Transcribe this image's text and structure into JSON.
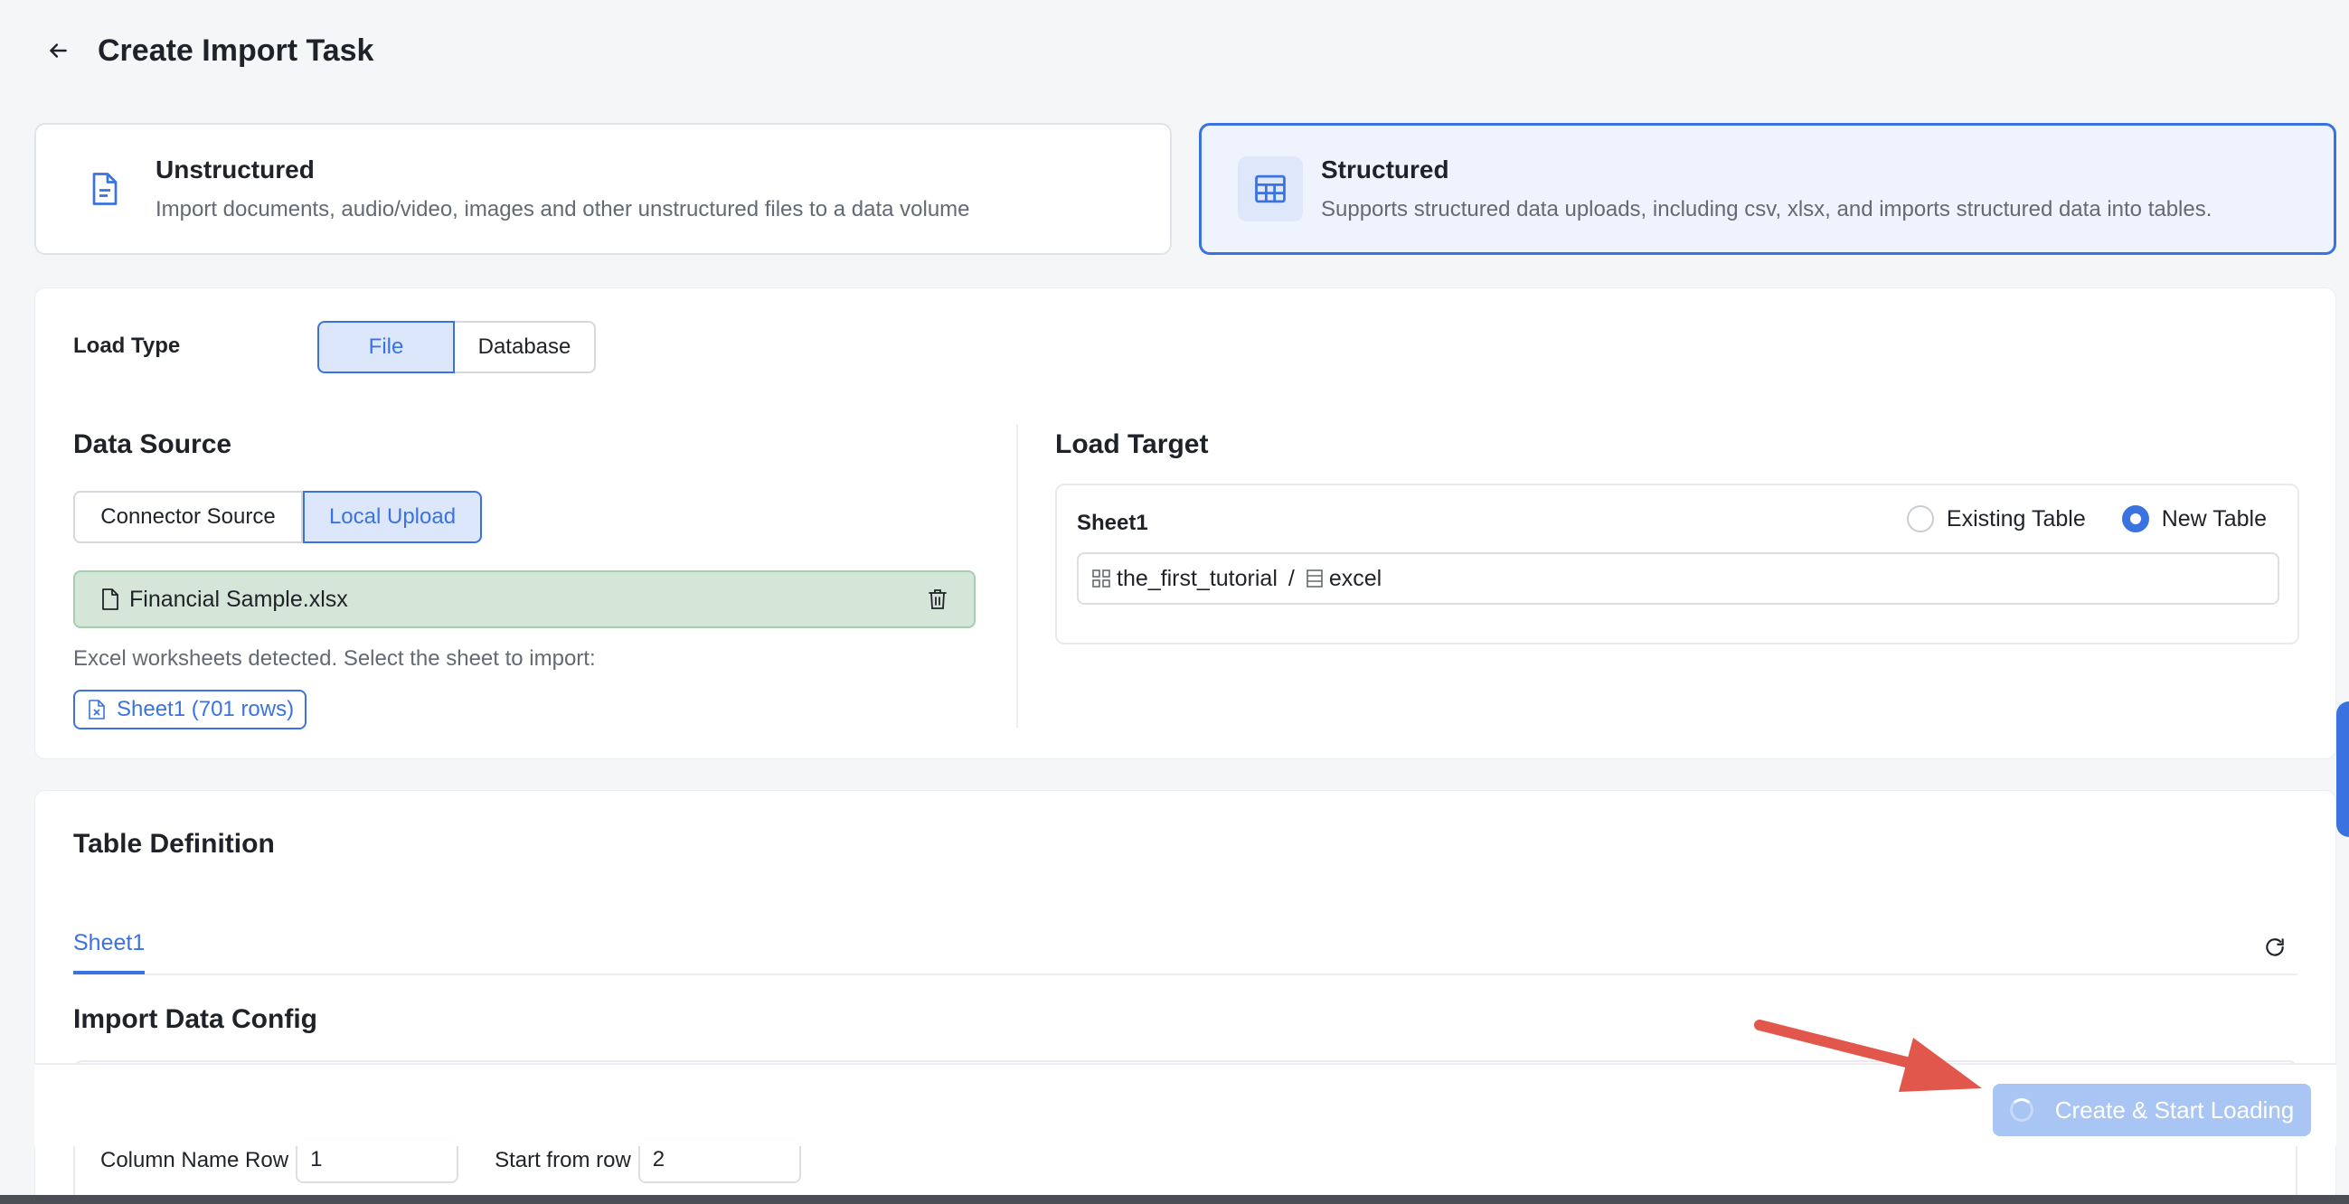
{
  "header": {
    "title": "Create Import Task"
  },
  "import_types": {
    "unstructured": {
      "title": "Unstructured",
      "description": "Import documents, audio/video, images and other unstructured files to a data volume"
    },
    "structured": {
      "title": "Structured",
      "description": "Supports structured data uploads, including csv, xlsx, and imports structured data into tables."
    }
  },
  "load_type": {
    "label": "Load Type",
    "options": [
      "File",
      "Database"
    ],
    "selected": "File"
  },
  "data_source": {
    "title": "Data Source",
    "options": [
      "Connector Source",
      "Local Upload"
    ],
    "selected": "Local Upload",
    "file_name": "Financial Sample.xlsx",
    "hint": "Excel worksheets detected. Select the sheet to import:",
    "sheet_chip": "Sheet1 (701 rows)"
  },
  "load_target": {
    "title": "Load Target",
    "sheet": "Sheet1",
    "options": [
      "Existing Table",
      "New Table"
    ],
    "selected": "New Table",
    "schema": "the_first_tutorial",
    "separator": "/",
    "table": "excel"
  },
  "table_definition": {
    "title": "Table Definition",
    "tabs": [
      "Sheet1"
    ],
    "active_tab": "Sheet1",
    "import_config_title": "Import Data Config",
    "column_name_row_label": "Column Name Row",
    "column_name_row_value": "1",
    "start_row_label": "Start from row",
    "start_row_value": "2"
  },
  "footer": {
    "primary_button": "Create & Start Loading",
    "loading": true
  },
  "colors": {
    "accent": "#3a73e0",
    "file_bar_bg": "#d5e6d8",
    "arrow": "#e2574c",
    "button_disabled": "#a9c5f4"
  }
}
